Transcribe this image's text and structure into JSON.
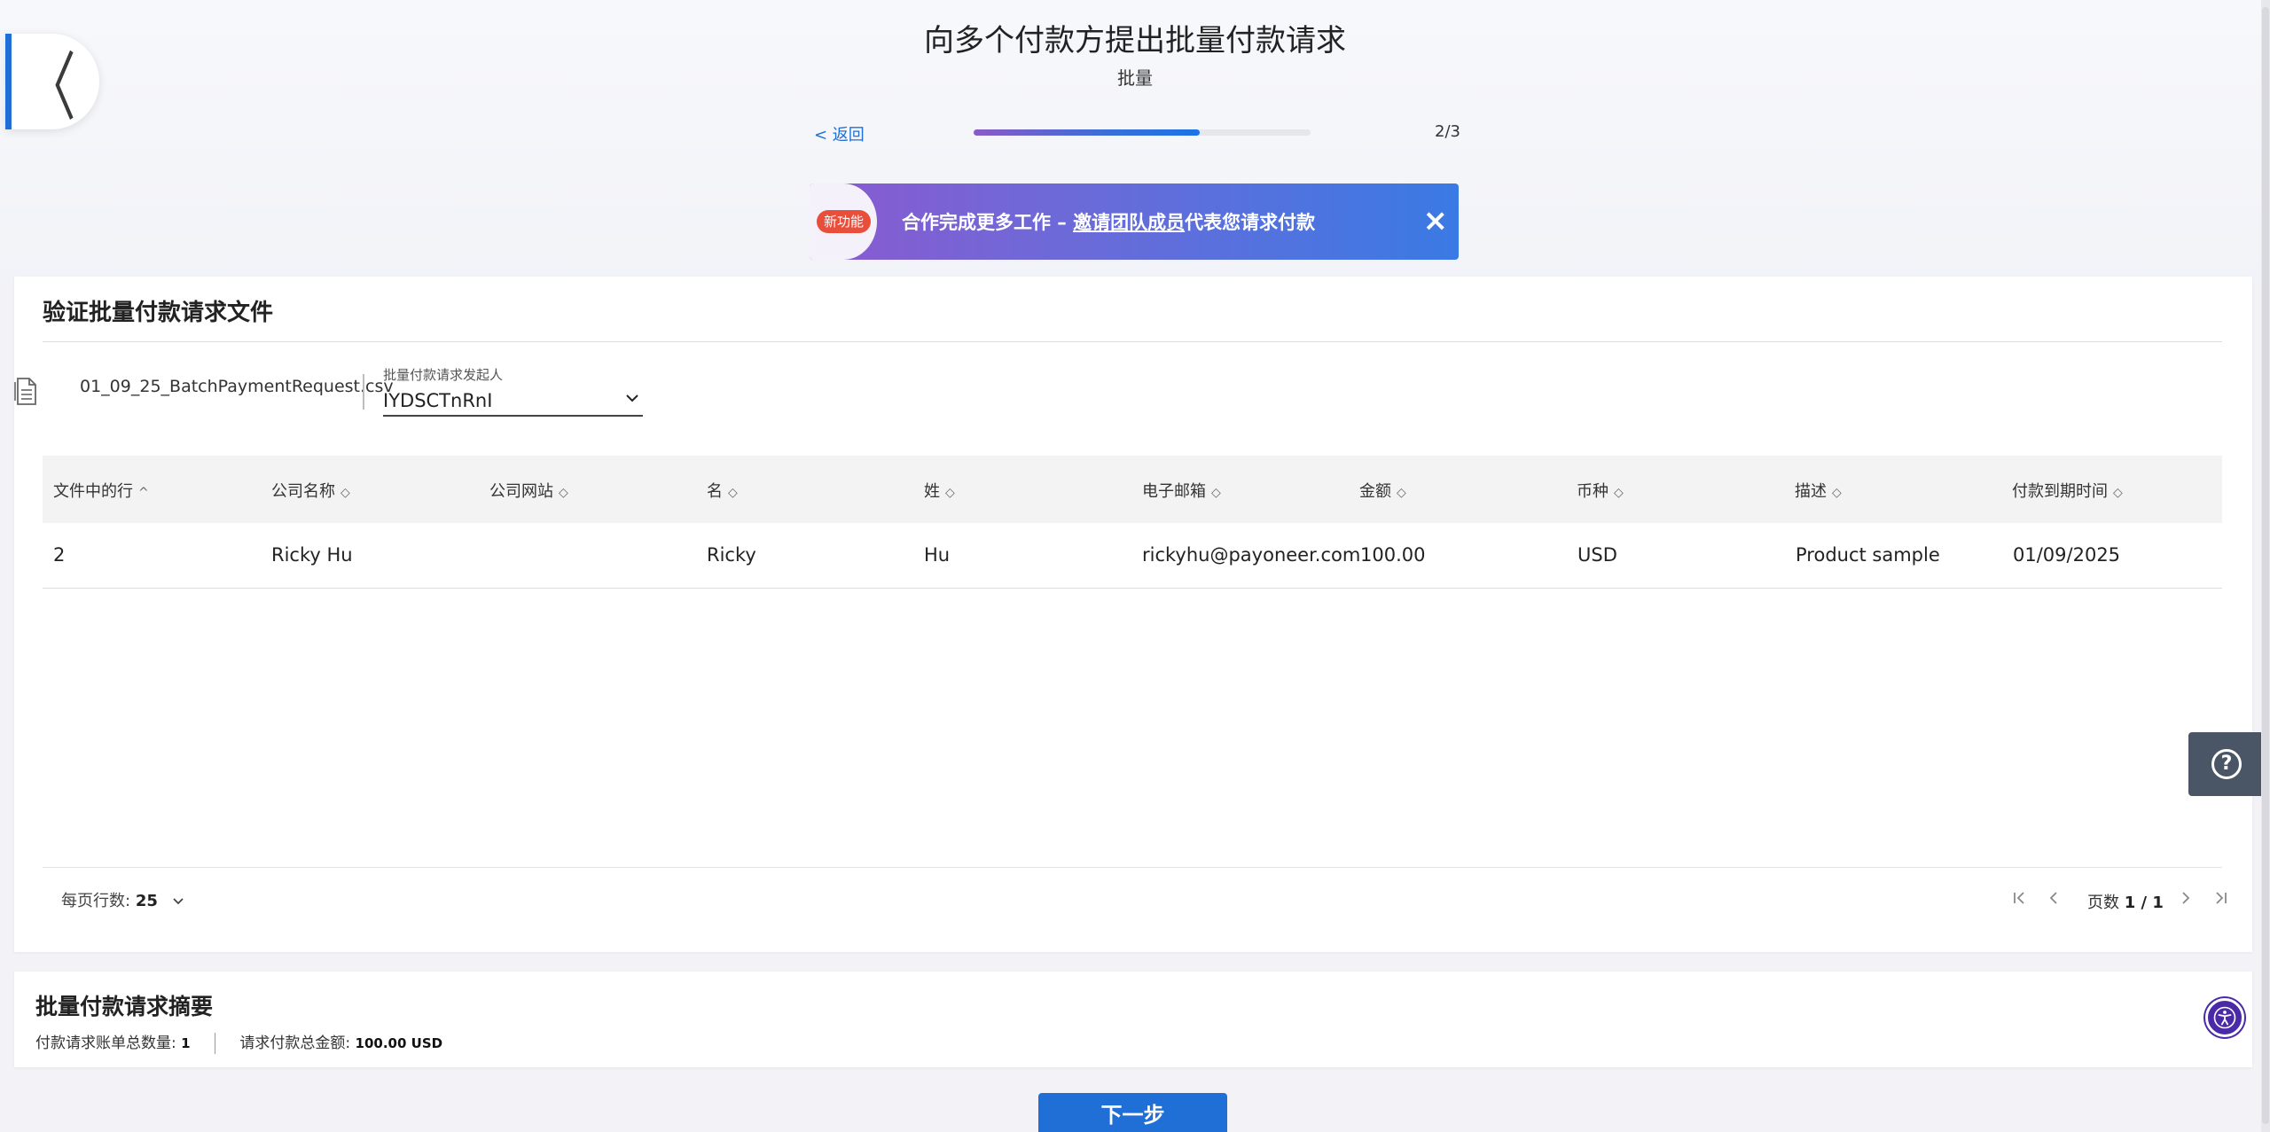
{
  "header": {
    "title": "向多个付款方提出批量付款请求",
    "subtitle": "批量",
    "back_link": "< 返回",
    "step": "2/3",
    "progress": 0.67
  },
  "banner": {
    "badge": "新功能",
    "text_before": "合作完成更多工作 – ",
    "link": "邀请团队成员",
    "text_after": "代表您请求付款",
    "close": "×"
  },
  "verify": {
    "title": "验证批量付款请求文件",
    "file_name": "01_09_25_BatchPaymentRequest.csv",
    "requester_label": "批量付款请求发起人",
    "requester_value": "IYDSCTnRnI"
  },
  "table": {
    "columns": [
      "文件中的行",
      "公司名称",
      "公司网站",
      "名",
      "姓",
      "电子邮箱",
      "金额",
      "币种",
      "描述",
      "付款到期时间"
    ],
    "sort_icons": [
      "^",
      "◇",
      "◇",
      "◇",
      "◇",
      "◇",
      "◇",
      "◇",
      "◇",
      "◇"
    ],
    "rows": [
      [
        "2",
        "Ricky Hu",
        "",
        "Ricky",
        "Hu",
        "rickyhu@payoneer.com",
        "100.00",
        "USD",
        "Product sample",
        "01/09/2025"
      ]
    ]
  },
  "pager": {
    "rows_per_page_label": "每页行数:",
    "rows_per_page_value": "25",
    "page_label": "页数",
    "page_value": "1 / 1"
  },
  "summary": {
    "title": "批量付款请求摘要",
    "count_label": "付款请求账单总数量:",
    "count_value": "1",
    "total_label": "请求付款总金额:",
    "total_value": "100.00 USD"
  },
  "actions": {
    "next": "下一步"
  },
  "icons": {
    "back": "chevron-left-icon",
    "file": "document-icon",
    "help": "help-icon",
    "accessibility": "accessibility-icon"
  },
  "colors": {
    "accent": "#1f6fd6",
    "badge": "#e94e3b",
    "help_bg": "#4a5566",
    "a11y": "#4b2aa8"
  }
}
